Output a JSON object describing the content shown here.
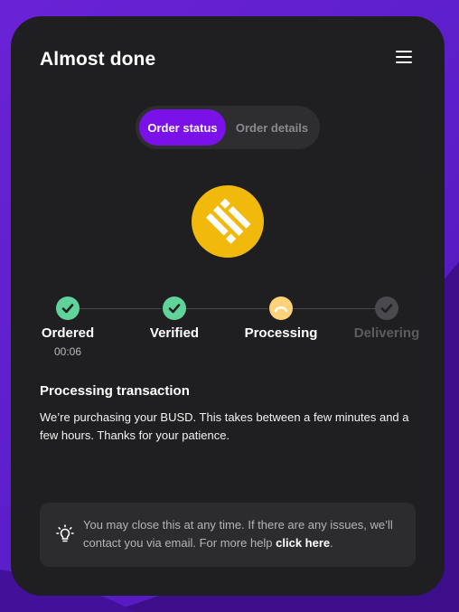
{
  "header": {
    "title": "Almost done",
    "menu_icon": "hamburger-menu-icon"
  },
  "tabs": [
    {
      "label": "Order status",
      "active": true
    },
    {
      "label": "Order details",
      "active": false
    }
  ],
  "coin": {
    "icon": "busd-icon",
    "color": "#f0b90b"
  },
  "steps": [
    {
      "label": "Ordered",
      "state": "done",
      "time": "00:06"
    },
    {
      "label": "Verified",
      "state": "done"
    },
    {
      "label": "Processing",
      "state": "active"
    },
    {
      "label": "Delivering",
      "state": "pending"
    }
  ],
  "status": {
    "title": "Processing transaction",
    "body": "We’re purchasing your BUSD. This takes between a few minutes and a few hours. Thanks for your patience."
  },
  "notice": {
    "icon": "lightbulb-icon",
    "text": "You may close this at any time. If there are any issues, we’ll contact you via email. For more help ",
    "link": "click here",
    "suffix": "."
  },
  "colors": {
    "accent": "#7a11e8",
    "done": "#5fd39a",
    "active": "#ffd27a",
    "pending": "#4a4a4e",
    "card": "#1f1f21"
  }
}
